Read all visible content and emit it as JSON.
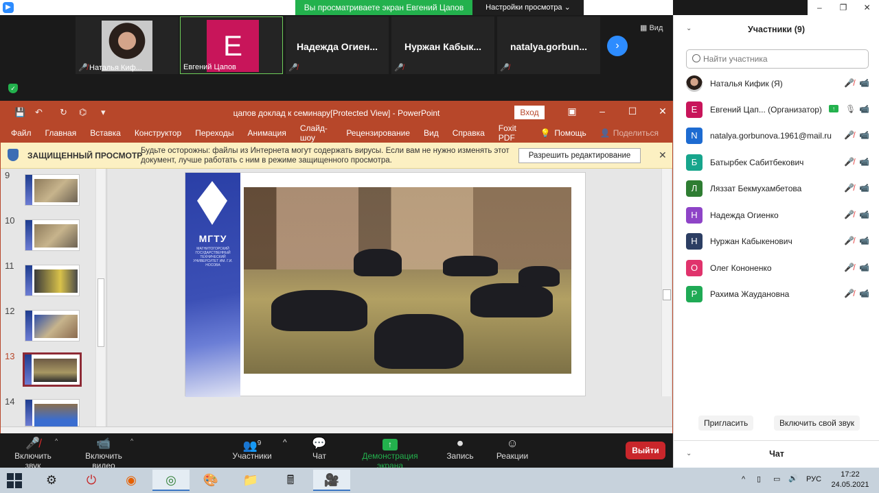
{
  "window": {
    "share_banner": "Вы просматриваете экран Евгений Цапов",
    "view_settings": "Настройки просмотра",
    "controls": [
      "–",
      "❐",
      "✕"
    ]
  },
  "video_strip": {
    "tiles": [
      {
        "name": "Наталья Киф...",
        "type": "photo"
      },
      {
        "name": "Евгений Цапов",
        "type": "avatar",
        "initial": "E",
        "color": "#c8155a"
      },
      {
        "name": "Надежда  Огиен...",
        "type": "name"
      },
      {
        "name": "Нуржан  Кабык...",
        "type": "name"
      },
      {
        "name": "natalya.gorbun...",
        "type": "name"
      }
    ],
    "view_label": "Вид"
  },
  "ppt": {
    "doc_title": "цапов доклад к семинару[Protected View]  -  PowerPoint",
    "login": "Вход",
    "menu": [
      "Файл",
      "Главная",
      "Вставка",
      "Конструктор",
      "Переходы",
      "Анимация",
      "Слайд-шоу",
      "Рецензирование",
      "Вид",
      "Справка",
      "Foxit PDF",
      "Помощь",
      "Поделиться"
    ],
    "protected": {
      "title": "ЗАЩИЩЕННЫЙ ПРОСМОТР",
      "message": "Будьте осторожны: файлы из Интернета могут содержать вирусы. Если вам не нужно изменять этот документ, лучше работать с ним в режиме защищенного просмотра.",
      "button": "Разрешить редактирование"
    },
    "thumbs": [
      "9",
      "10",
      "11",
      "12",
      "13",
      "14"
    ],
    "active_slide": "13",
    "slide": {
      "logo_text": "МГТУ",
      "logo_sub": "МАГНИТОГОРСКИЙ ГОСУДАРСТВЕННЫЙ ТЕХНИЧЕСКИЙ УНИВЕРСИТЕТ ИМ. Г.И. НОСОВА"
    }
  },
  "toolbar": {
    "mute": "Включить звук",
    "video": "Включить видео",
    "participants": "Участники",
    "participants_count": "9",
    "chat": "Чат",
    "share": "Демонстрация экрана",
    "record": "Запись",
    "reactions": "Реакции",
    "leave": "Выйти"
  },
  "panel": {
    "title": "Участники (9)",
    "search_placeholder": "Найти участника",
    "participants": [
      {
        "name": "Наталья Кифик (Я)",
        "initial": "",
        "color": "#b88a74",
        "photo": true
      },
      {
        "name": "Евгений Цап...  (Организатор)",
        "initial": "Е",
        "color": "#c8155a",
        "host": true
      },
      {
        "name": "natalya.gorbunova.1961@mail.ru",
        "initial": "N",
        "color": "#1d6bd1"
      },
      {
        "name": "Батырбек Сабитбекович",
        "initial": "Б",
        "color": "#17a58c"
      },
      {
        "name": "Ляззат Бекмухамбетова",
        "initial": "Л",
        "color": "#2e7d32"
      },
      {
        "name": "Надежда Огиенко",
        "initial": "Н",
        "color": "#8e44c7"
      },
      {
        "name": "Нуржан Кабыкенович",
        "initial": "Н",
        "color": "#2c3e63"
      },
      {
        "name": "Олег Кононенко",
        "initial": "О",
        "color": "#e0336c"
      },
      {
        "name": "Рахима Жаудановна",
        "initial": "Р",
        "color": "#1faa55"
      }
    ],
    "invite": "Пригласить",
    "unmute_self": "Включить свой звук",
    "chat_title": "Чат"
  },
  "taskbar": {
    "apps": [
      "settings",
      "power",
      "firefox",
      "chrome",
      "paint",
      "folder",
      "calculator",
      "zoom"
    ],
    "lang": "РУС",
    "time": "17:22",
    "date": "24.05.2021"
  }
}
